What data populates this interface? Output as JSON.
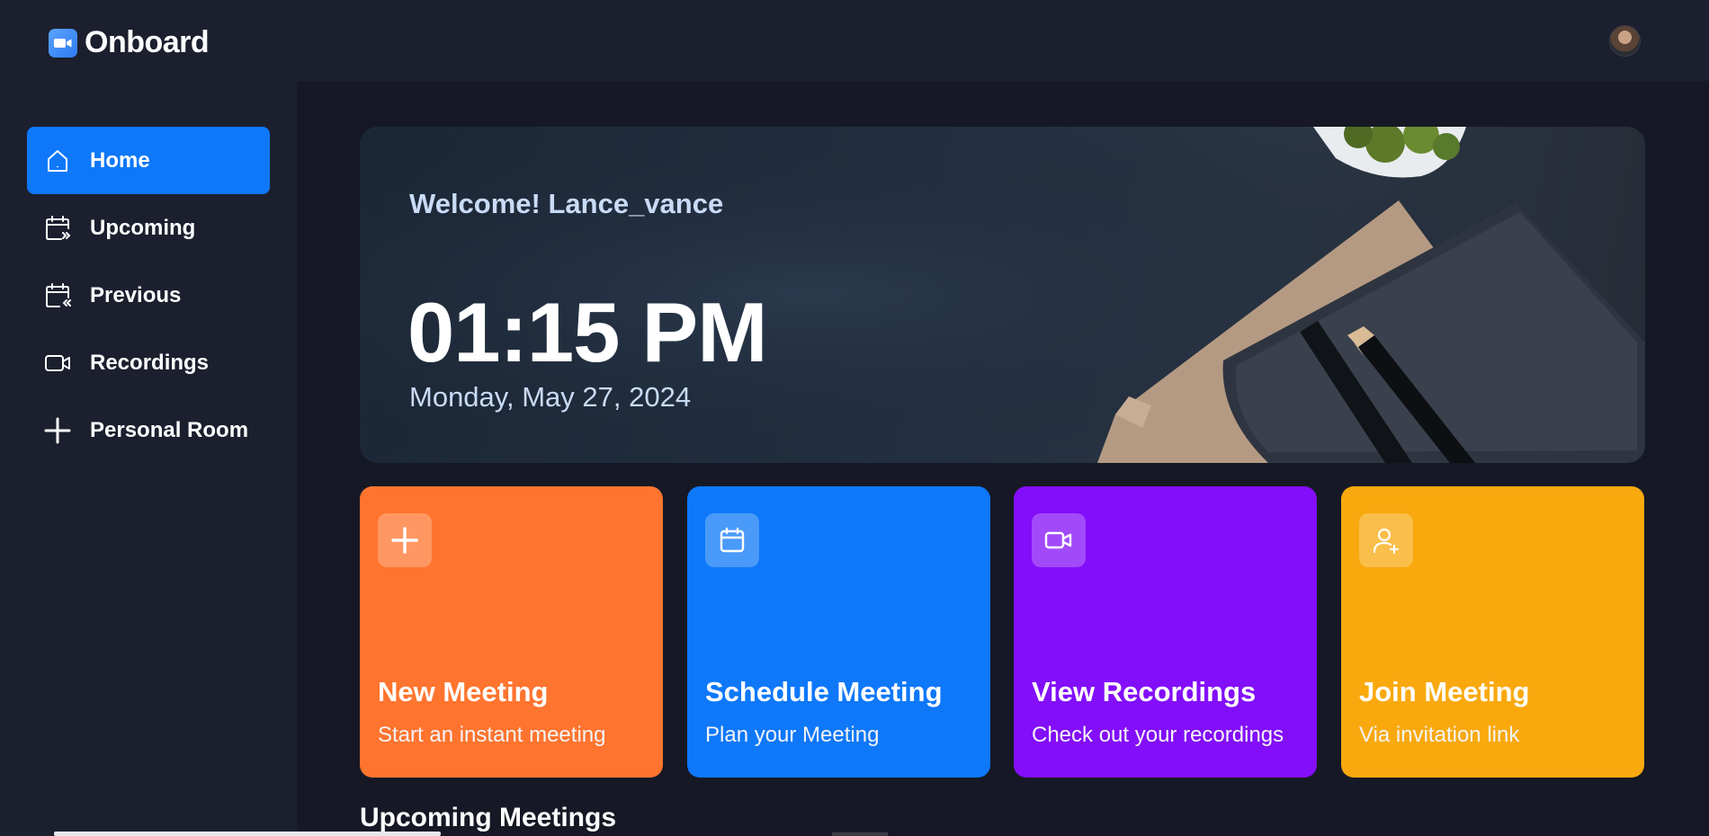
{
  "app": {
    "name": "Onboard"
  },
  "header": {
    "avatar_icon": "user-avatar-icon"
  },
  "sidebar": {
    "items": [
      {
        "label": "Home",
        "icon": "home-icon",
        "active": true
      },
      {
        "label": "Upcoming",
        "icon": "calendar-upcoming-icon",
        "active": false
      },
      {
        "label": "Previous",
        "icon": "calendar-previous-icon",
        "active": false
      },
      {
        "label": "Recordings",
        "icon": "video-camera-icon",
        "active": false
      },
      {
        "label": "Personal Room",
        "icon": "plus-icon",
        "active": false
      }
    ]
  },
  "hero": {
    "welcome": "Welcome! Lance_vance",
    "time": "01:15 PM",
    "date": "Monday, May 27, 2024"
  },
  "cards": [
    {
      "title": "New Meeting",
      "subtitle": "Start an instant meeting",
      "icon": "plus-icon",
      "color": "#ff742e"
    },
    {
      "title": "Schedule Meeting",
      "subtitle": "Plan your Meeting",
      "icon": "calendar-icon",
      "color": "#0e78f9"
    },
    {
      "title": "View Recordings",
      "subtitle": "Check out your recordings",
      "icon": "video-camera-icon",
      "color": "#830ef9"
    },
    {
      "title": "Join Meeting",
      "subtitle": "Via invitation link",
      "icon": "add-user-icon",
      "color": "#f9a90e"
    }
  ],
  "sections": {
    "upcoming_title": "Upcoming Meetings"
  },
  "theme": {
    "accent": "#0e78f9",
    "sidebar_bg": "#1c1f2e",
    "page_bg": "#161925"
  }
}
